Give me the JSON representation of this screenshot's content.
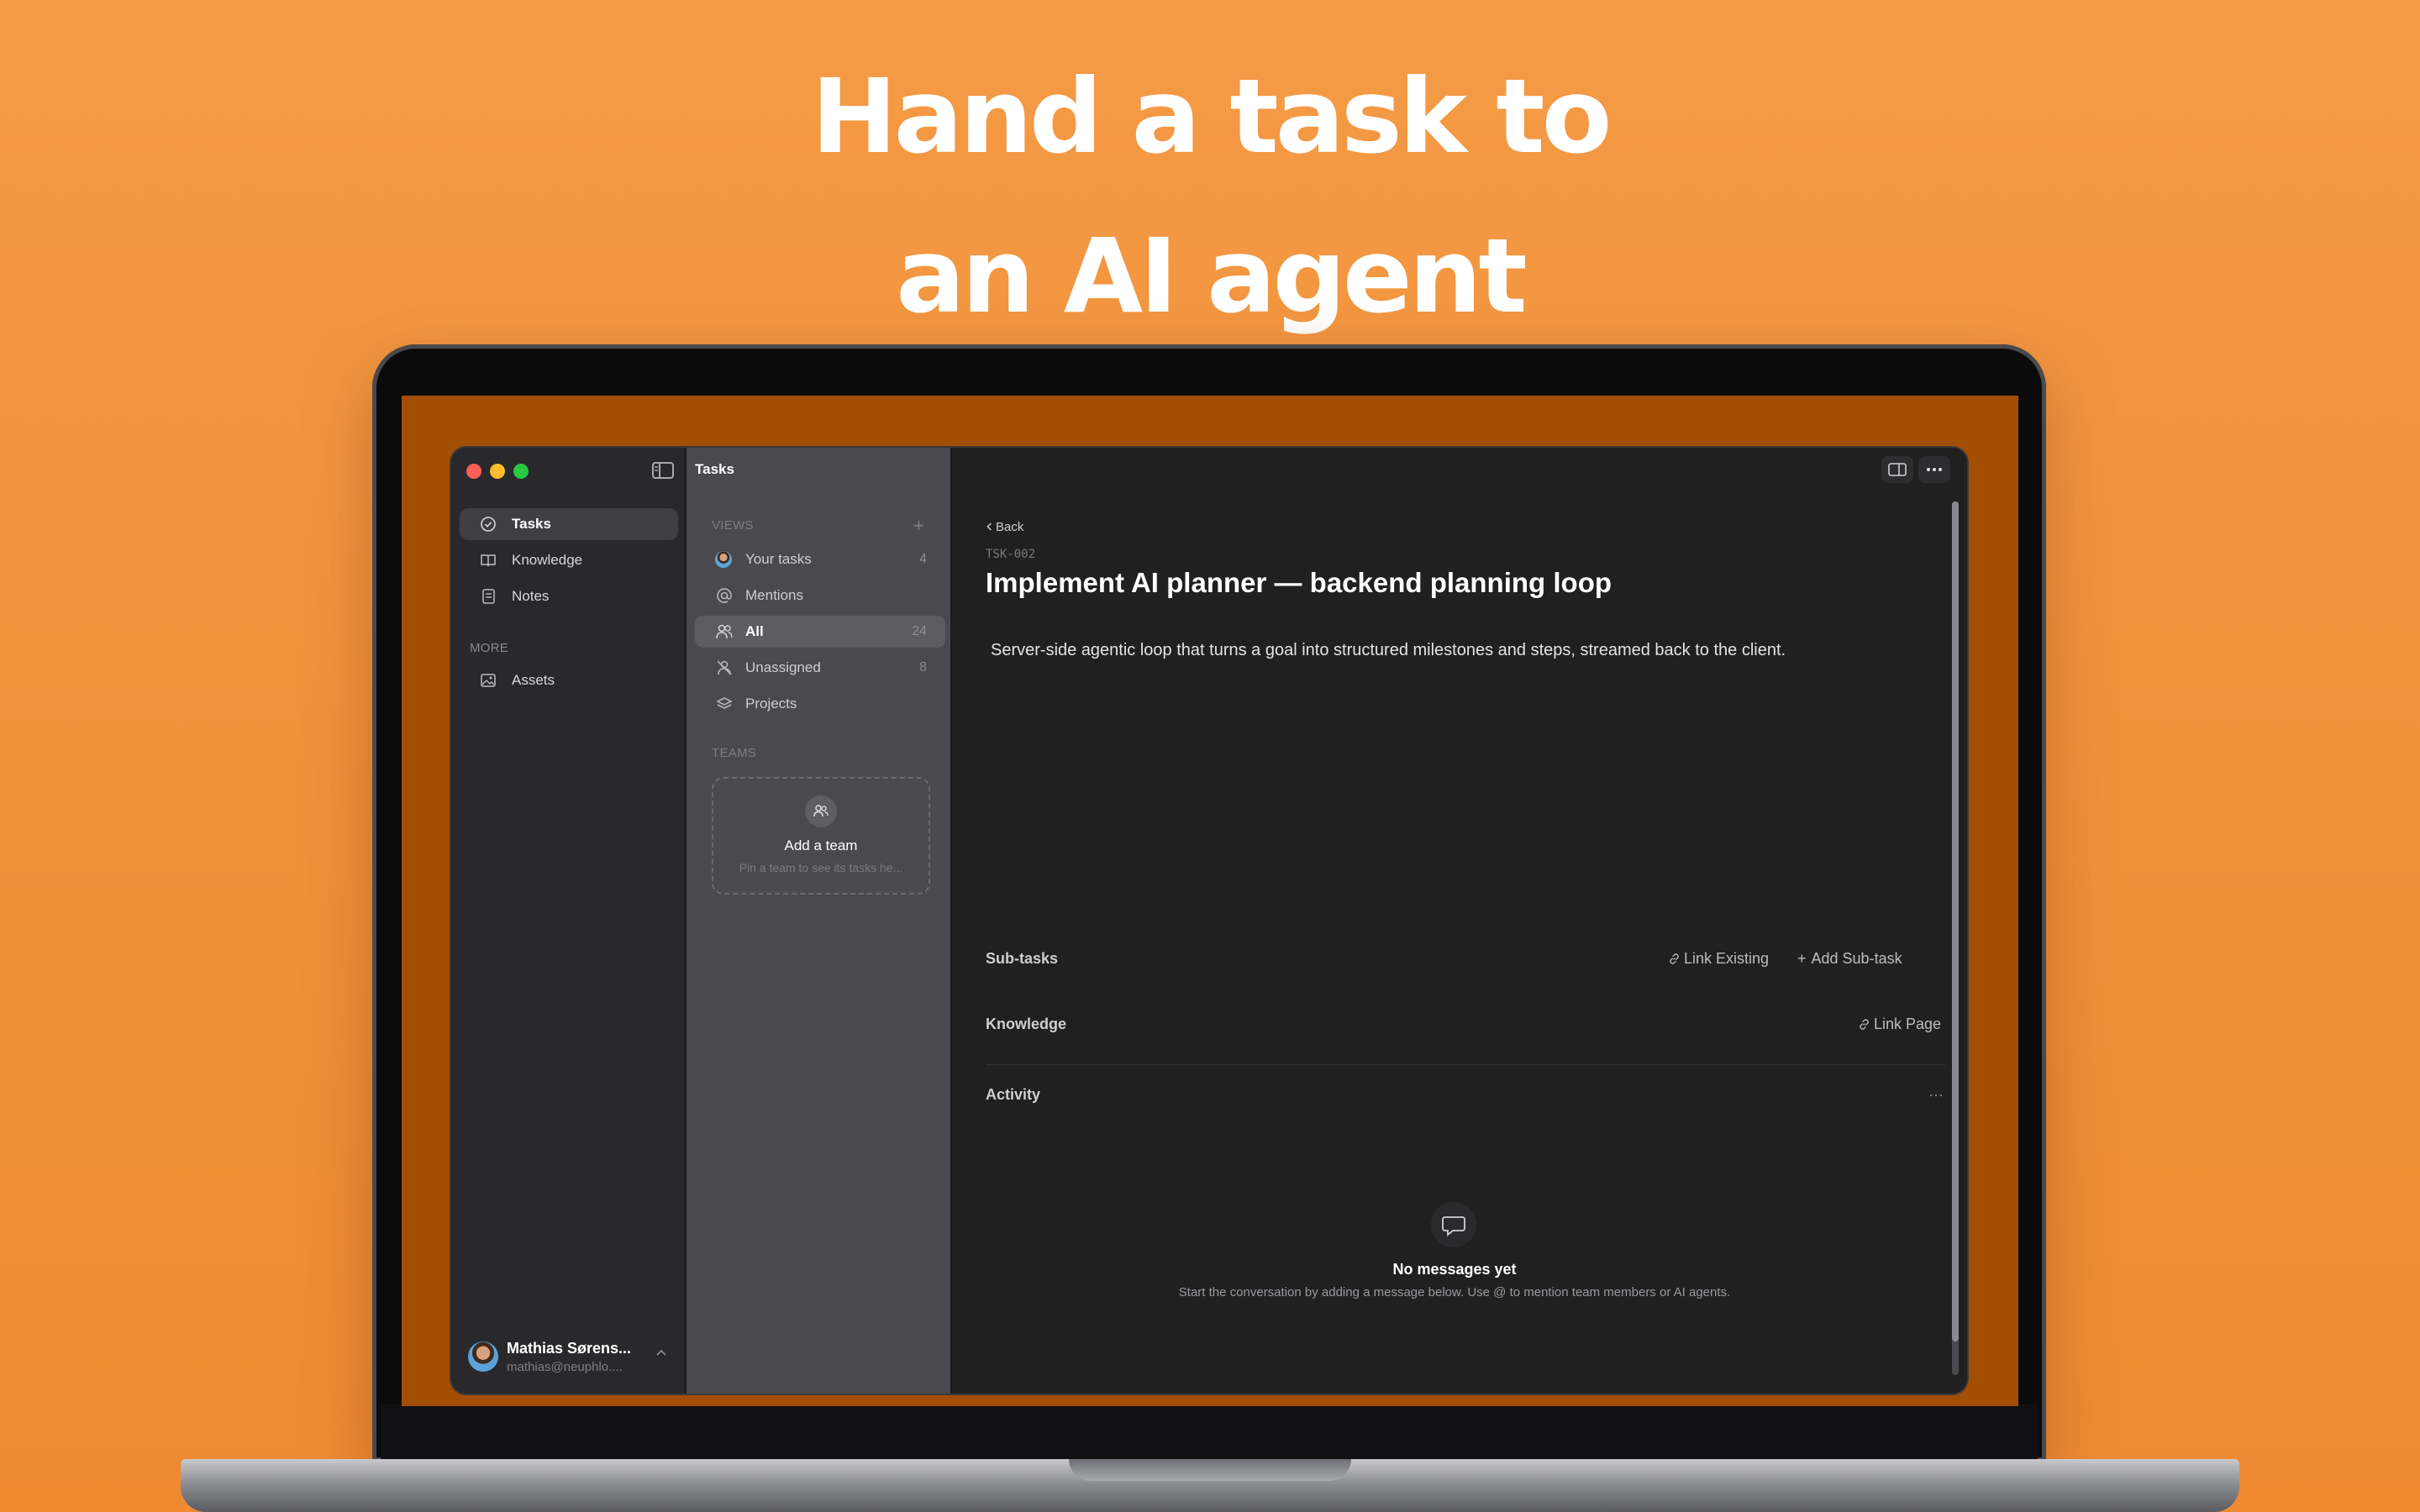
{
  "headline": {
    "line1": "Hand a task to",
    "line2": "an AI agent"
  },
  "colors": {
    "background": "#f1913a",
    "accent": "#ffffff",
    "window_bg": "#202021"
  },
  "sidebar": {
    "items": [
      {
        "label": "Tasks",
        "icon": "check-circle-icon",
        "active": true
      },
      {
        "label": "Knowledge",
        "icon": "book-icon"
      },
      {
        "label": "Notes",
        "icon": "notes-icon"
      }
    ],
    "more_label": "MORE",
    "more_items": [
      {
        "label": "Assets",
        "icon": "image-icon"
      }
    ],
    "user": {
      "name": "Mathias Sørens...",
      "email": "mathias@neuphlo...."
    }
  },
  "tasks_panel": {
    "title": "Tasks",
    "views_label": "VIEWS",
    "views": [
      {
        "label": "Your tasks",
        "count": "4",
        "icon": "avatar-icon"
      },
      {
        "label": "Mentions",
        "count": "",
        "icon": "at-icon"
      },
      {
        "label": "All",
        "count": "24",
        "icon": "people-icon",
        "active": true
      },
      {
        "label": "Unassigned",
        "count": "8",
        "icon": "person-slash-icon"
      },
      {
        "label": "Projects",
        "count": "",
        "icon": "layers-icon"
      }
    ],
    "teams_label": "TEAMS",
    "add_team": {
      "title": "Add a team",
      "subtitle": "Pin a team to see its tasks he..."
    }
  },
  "task": {
    "back_label": "Back",
    "id": "TSK-002",
    "title": "Implement AI planner — backend planning loop",
    "description": "Server-side agentic loop that turns a goal into structured milestones and steps, streamed back to the client.",
    "subtasks_label": "Sub-tasks",
    "link_existing": "Link Existing",
    "add_subtask": "Add Sub-task",
    "knowledge_label": "Knowledge",
    "link_page": "Link Page",
    "activity_label": "Activity",
    "empty_title": "No messages yet",
    "empty_subtitle": "Start the conversation by adding a message below. Use @ to mention team members or AI agents."
  }
}
